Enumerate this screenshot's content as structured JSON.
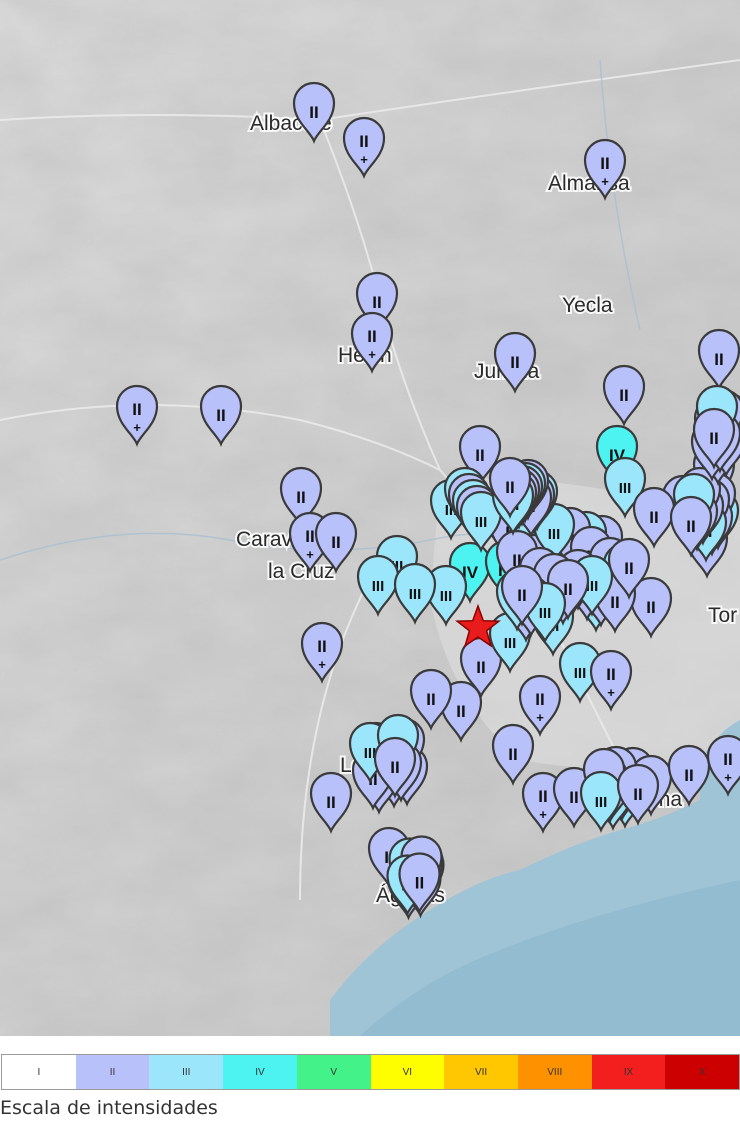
{
  "map": {
    "places": [
      "Albacete",
      "Almansa",
      "Yecla",
      "Hellín",
      "Jumilla",
      "Caravaca de",
      "la Cruz",
      "Lorca",
      "Águilas",
      "Cartagena",
      "Tor"
    ],
    "epicenter_icon": "star-icon",
    "pins": [
      {
        "label": "II",
        "cross": false
      },
      {
        "label": "II",
        "cross": true
      },
      {
        "label": "II",
        "cross": true
      },
      {
        "label": "II",
        "cross": false
      },
      {
        "label": "II",
        "cross": true
      },
      {
        "label": "II",
        "cross": false
      },
      {
        "label": "II",
        "cross": false
      },
      {
        "label": "II",
        "cross": false
      },
      {
        "label": "II",
        "cross": true
      },
      {
        "label": "II",
        "cross": false
      },
      {
        "label": "II",
        "cross": false
      },
      {
        "label": "III",
        "cross": false
      },
      {
        "label": "IV",
        "cross": false
      },
      {
        "label": "III",
        "cross": false
      },
      {
        "label": "III",
        "cross": false
      },
      {
        "label": "IV",
        "cross": false
      },
      {
        "label": "IV",
        "cross": false
      },
      {
        "label": "III",
        "cross": false
      },
      {
        "label": "III",
        "cross": false
      },
      {
        "label": "II",
        "cross": true
      },
      {
        "label": "II",
        "cross": false
      },
      {
        "label": "III",
        "cross": false
      },
      {
        "label": "II",
        "cross": true
      },
      {
        "label": "II",
        "cross": false
      },
      {
        "label": "III",
        "cross": false
      },
      {
        "label": "III",
        "cross": false
      },
      {
        "label": "II",
        "cross": true
      },
      {
        "label": "II",
        "cross": false
      },
      {
        "label": "II",
        "cross": true
      },
      {
        "label": "II",
        "cross": false
      },
      {
        "label": "II",
        "cross": false
      },
      {
        "label": "III",
        "cross": false
      },
      {
        "label": "II",
        "cross": false
      },
      {
        "label": "II",
        "cross": false
      },
      {
        "label": "II",
        "cross": true
      },
      {
        "label": "II",
        "cross": false
      },
      {
        "label": "II",
        "cross": true
      },
      {
        "label": "II",
        "cross": false
      },
      {
        "label": "II",
        "cross": false
      },
      {
        "label": "II",
        "cross": false
      },
      {
        "label": "II",
        "cross": false
      },
      {
        "label": "II",
        "cross": true
      },
      {
        "label": "II",
        "cross": false
      },
      {
        "label": "III",
        "cross": false
      },
      {
        "label": "II",
        "cross": false
      },
      {
        "label": "II",
        "cross": false
      },
      {
        "label": "II",
        "cross": false
      },
      {
        "label": "II",
        "cross": false
      },
      {
        "label": "II",
        "cross": false
      }
    ]
  },
  "legend": {
    "title": "Escala de intensidades",
    "levels": [
      {
        "label": "I",
        "color": "#ffffff"
      },
      {
        "label": "II",
        "color": "#b9c1fb"
      },
      {
        "label": "III",
        "color": "#9ce6fb"
      },
      {
        "label": "IV",
        "color": "#4df3f1"
      },
      {
        "label": "V",
        "color": "#43f38a"
      },
      {
        "label": "VI",
        "color": "#fefe00"
      },
      {
        "label": "VII",
        "color": "#fec700"
      },
      {
        "label": "VIII",
        "color": "#fe9100"
      },
      {
        "label": "IX",
        "color": "#f31f1f"
      },
      {
        "label": "X",
        "color": "#cc0000"
      }
    ]
  }
}
